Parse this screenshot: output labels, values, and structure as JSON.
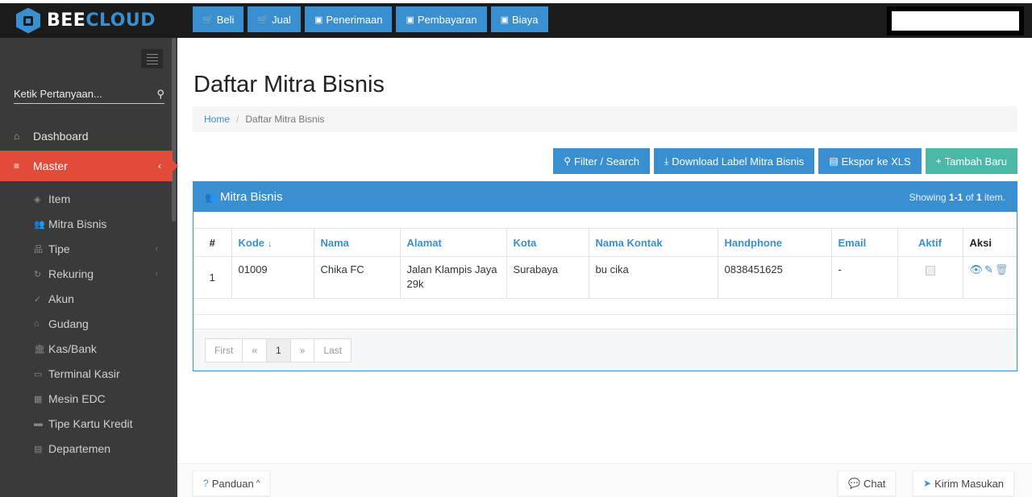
{
  "brand": {
    "bee": "BEE",
    "cloud": "CLOUD"
  },
  "topnav": [
    {
      "label": "Beli",
      "icon": "cart-icon"
    },
    {
      "label": "Jual",
      "icon": "cart-icon"
    },
    {
      "label": "Penerimaan",
      "icon": "money-icon"
    },
    {
      "label": "Pembayaran",
      "icon": "money-icon"
    },
    {
      "label": "Biaya",
      "icon": "money-icon"
    }
  ],
  "sidebar": {
    "search_placeholder": "Ketik Pertanyaan...",
    "items": [
      {
        "label": "Dashboard",
        "icon": "home-icon"
      },
      {
        "label": "Master",
        "icon": "database-icon",
        "active": true
      }
    ],
    "subitems": [
      {
        "label": "Item",
        "icon": "cube-icon"
      },
      {
        "label": "Mitra Bisnis",
        "icon": "users-icon"
      },
      {
        "label": "Tipe",
        "icon": "sitemap-icon",
        "has_children": true
      },
      {
        "label": "Rekuring",
        "icon": "refresh-icon",
        "has_children": true
      },
      {
        "label": "Akun",
        "icon": "check-icon"
      },
      {
        "label": "Gudang",
        "icon": "home-icon"
      },
      {
        "label": "Kas/Bank",
        "icon": "bank-icon"
      },
      {
        "label": "Terminal Kasir",
        "icon": "monitor-icon"
      },
      {
        "label": "Mesin EDC",
        "icon": "calculator-icon"
      },
      {
        "label": "Tipe Kartu Kredit",
        "icon": "credit-card-icon"
      },
      {
        "label": "Departemen",
        "icon": "building-icon"
      }
    ]
  },
  "page": {
    "title": "Daftar Mitra Bisnis",
    "breadcrumb": {
      "home": "Home",
      "current": "Daftar Mitra Bisnis"
    }
  },
  "actions": {
    "filter": "Filter / Search",
    "download": "Download Label Mitra Bisnis",
    "export": "Ekspor ke XLS",
    "add": "Tambah Baru"
  },
  "panel": {
    "title": "Mitra Bisnis",
    "showing_prefix": "Showing ",
    "showing_range": "1-1",
    "showing_of": " of ",
    "showing_total": "1",
    "showing_suffix": " item."
  },
  "table": {
    "headers": [
      "#",
      "Kode",
      "Nama",
      "Alamat",
      "Kota",
      "Nama Kontak",
      "Handphone",
      "Email",
      "Aktif",
      "Aksi"
    ],
    "rows": [
      {
        "no": "1",
        "kode": "01009",
        "nama": "Chika FC",
        "alamat": "Jalan Klampis Jaya 29k",
        "kota": "Surabaya",
        "kontak": "bu cika",
        "hp": "0838451625",
        "email": "-",
        "aktif": true
      }
    ]
  },
  "pagination": {
    "first": "First",
    "prev": "«",
    "current": "1",
    "next": "»",
    "last": "Last"
  },
  "footer": {
    "panduan": "Panduan",
    "chat": "Chat",
    "kirim": "Kirim Masukan"
  },
  "colors": {
    "primary": "#3a8fd0",
    "active": "#e24b3a",
    "teal": "#4cb9a8",
    "sidebar": "#3a3a3a",
    "topbar": "#1b1b1b"
  }
}
